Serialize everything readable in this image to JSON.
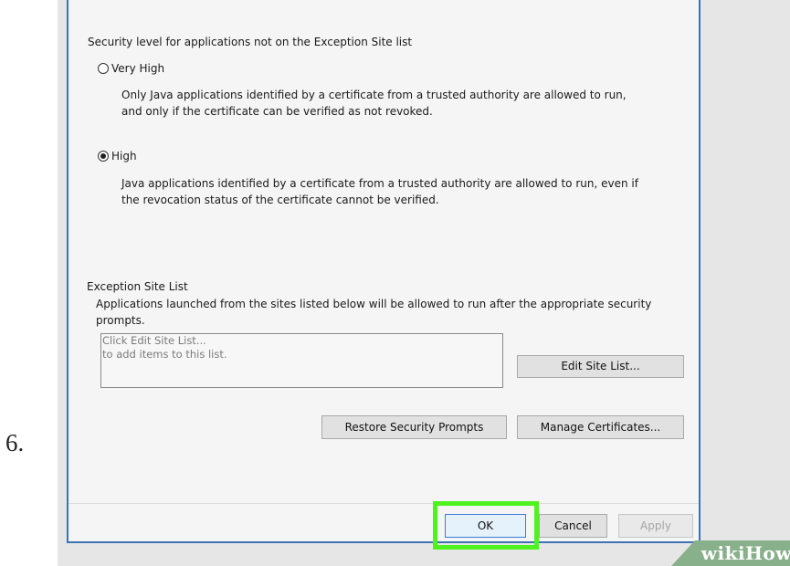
{
  "step_number": "6.",
  "security": {
    "heading": "Security level for applications not on the Exception Site list",
    "options": [
      {
        "label": "Very High",
        "selected": false,
        "description": [
          "Only Java applications identified by a certificate from a trusted authority are allowed to run,",
          "and only if the certificate can be verified as not revoked."
        ]
      },
      {
        "label": "High",
        "selected": true,
        "description": [
          "Java applications identified by a certificate from a trusted authority are allowed to run, even if",
          "the revocation status of the certificate cannot be verified."
        ]
      }
    ]
  },
  "exception": {
    "heading": "Exception Site List",
    "description": [
      "Applications launched from the sites listed below will be allowed to run after the appropriate security",
      "prompts."
    ],
    "list_placeholder": [
      "Click Edit Site List...",
      "to add items to this list."
    ],
    "edit_button": "Edit Site List..."
  },
  "buttons": {
    "restore_prompts": "Restore Security Prompts",
    "manage_certificates": "Manage Certificates...",
    "ok": "OK",
    "cancel": "Cancel",
    "apply": "Apply"
  },
  "watermark": "wikiHow",
  "colors": {
    "dialog_border": "#3d72b4",
    "highlight": "#4ef21e",
    "watermark_bg": "#88b08a"
  }
}
